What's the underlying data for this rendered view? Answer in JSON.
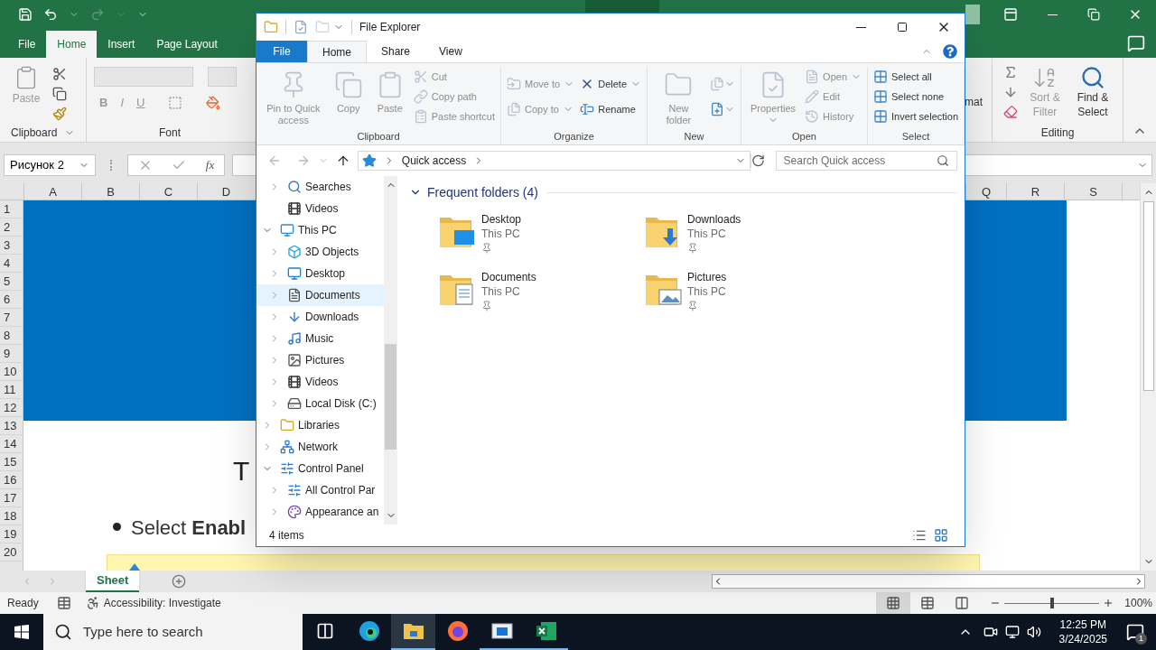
{
  "excel": {
    "tabs": [
      {
        "label": "File",
        "selected": false
      },
      {
        "label": "Home",
        "selected": true
      },
      {
        "label": "Insert",
        "selected": false
      },
      {
        "label": "Page Layout",
        "selected": false
      }
    ],
    "ribbon": {
      "clipboard": {
        "label": "Clipboard",
        "paste": {
          "label": "Paste",
          "disabled": true
        }
      },
      "font": {
        "label": "Font",
        "styles": [
          "B",
          "I",
          "U"
        ]
      },
      "format_fragment": "mat",
      "editing": {
        "label": "Editing",
        "sort_filter": {
          "label": "Sort & Filter",
          "disabled": true
        },
        "find_select": {
          "label": "Find & Select",
          "disabled": false
        }
      }
    },
    "name_box": "Рисунок 2",
    "formula_label": "fx",
    "columns_left": [
      "A",
      "B",
      "C",
      "D"
    ],
    "columns_right": [
      "Q",
      "R",
      "S"
    ],
    "rows": [
      "1",
      "2",
      "3",
      "4",
      "5",
      "6",
      "7",
      "8",
      "9",
      "10",
      "11",
      "12",
      "13",
      "14",
      "15",
      "16",
      "17",
      "18",
      "19",
      "20"
    ],
    "sheet_text": {
      "heading_fragment": "T",
      "bullet": "Select **Enabl**"
    },
    "sheet_tabs": [
      {
        "label": "Sheet",
        "selected": true
      }
    ],
    "status": {
      "mode": "Ready",
      "accessibility": "Accessibility: Investigate",
      "zoom": "100%",
      "zoom_slider": {
        "level": 0.5
      },
      "views": [
        {
          "selected": true
        },
        {
          "selected": false
        },
        {
          "selected": false
        }
      ]
    }
  },
  "explorer": {
    "title": "File Explorer",
    "tabs": [
      {
        "label": "File",
        "kind": "file",
        "selected": false
      },
      {
        "label": "Home",
        "kind": "tab",
        "selected": true
      },
      {
        "label": "Share",
        "kind": "tab",
        "selected": false
      },
      {
        "label": "View",
        "kind": "tab",
        "selected": false
      }
    ],
    "ribbon": [
      {
        "label": "Clipboard",
        "columns": [
          [
            {
              "label": "Pin to Quick access",
              "kind": "large",
              "disabled": true,
              "dropdown": false
            }
          ],
          [
            {
              "label": "Copy",
              "kind": "large",
              "disabled": true,
              "dropdown": false
            }
          ],
          [
            {
              "label": "Paste",
              "kind": "large",
              "disabled": true,
              "dropdown": false
            }
          ],
          [
            {
              "label": "Cut",
              "kind": "small",
              "disabled": true,
              "dropdown": false
            },
            {
              "label": "Copy path",
              "kind": "small",
              "disabled": true,
              "dropdown": false
            },
            {
              "label": "Paste shortcut",
              "kind": "small",
              "disabled": true,
              "dropdown": false
            }
          ]
        ]
      },
      {
        "label": "Organize",
        "columns": [
          [
            {
              "label": "Move to",
              "kind": "small",
              "disabled": true,
              "dropdown": true
            },
            {
              "label": "Copy to",
              "kind": "small",
              "disabled": true,
              "dropdown": true
            }
          ],
          [
            {
              "label": "Delete",
              "kind": "small",
              "disabled": false,
              "dropdown": true
            },
            {
              "label": "Rename",
              "kind": "small",
              "disabled": false,
              "dropdown": false
            }
          ]
        ]
      },
      {
        "label": "New",
        "columns": [
          [
            {
              "label": "New folder",
              "kind": "large",
              "disabled": true,
              "dropdown": false
            }
          ],
          [
            {
              "kind": "icon",
              "disabled": true,
              "dropdown": true
            },
            {
              "kind": "icon",
              "disabled": false,
              "dropdown": true
            }
          ]
        ]
      },
      {
        "label": "Open",
        "columns": [
          [
            {
              "label": "Properties",
              "kind": "large",
              "disabled": true,
              "dropdown": true
            }
          ],
          [
            {
              "label": "Open",
              "kind": "small",
              "disabled": true,
              "dropdown": true
            },
            {
              "label": "Edit",
              "kind": "small",
              "disabled": true,
              "dropdown": false
            },
            {
              "label": "History",
              "kind": "small",
              "disabled": true,
              "dropdown": false
            }
          ]
        ]
      },
      {
        "label": "Select",
        "columns": [
          [
            {
              "label": "Select all",
              "kind": "small",
              "disabled": false,
              "dropdown": false
            },
            {
              "label": "Select none",
              "kind": "small",
              "disabled": false,
              "dropdown": false
            },
            {
              "label": "Invert selection",
              "kind": "small",
              "disabled": false,
              "dropdown": false
            }
          ]
        ]
      }
    ],
    "address": "Quick access",
    "search": {
      "placeholder": "Search Quick access"
    },
    "nav": [
      {
        "children": [
          {
            "label": "Searches",
            "kind": "node",
            "expanded": false,
            "selected": false
          },
          {
            "label": "Videos",
            "kind": "leaf",
            "selected": false
          }
        ]
      },
      {
        "label": "This PC",
        "kind": "node",
        "expanded": true,
        "selected": false,
        "children": [
          {
            "label": "3D Objects",
            "kind": "node",
            "expanded": false,
            "selected": false
          },
          {
            "label": "Desktop",
            "kind": "node",
            "expanded": false,
            "selected": false
          },
          {
            "label": "Documents",
            "kind": "node",
            "expanded": false,
            "selected": true
          },
          {
            "label": "Downloads",
            "kind": "node",
            "expanded": false,
            "selected": false
          },
          {
            "label": "Music",
            "kind": "node",
            "expanded": false,
            "selected": false
          },
          {
            "label": "Pictures",
            "kind": "node",
            "expanded": false,
            "selected": false
          },
          {
            "label": "Videos",
            "kind": "node",
            "expanded": false,
            "selected": false
          },
          {
            "label": "Local Disk (C:)",
            "kind": "node",
            "expanded": false,
            "selected": false
          }
        ]
      },
      {
        "label": "Libraries",
        "kind": "node",
        "expanded": false,
        "selected": false
      },
      {
        "label": "Network",
        "kind": "node",
        "expanded": false,
        "selected": false
      },
      {
        "label": "Control Panel",
        "kind": "node",
        "expanded": true,
        "selected": false,
        "children": [
          {
            "label": "All Control Par",
            "kind": "node",
            "expanded": false,
            "selected": false
          },
          {
            "label": "Appearance an",
            "kind": "node",
            "expanded": false,
            "selected": false
          }
        ]
      }
    ],
    "section": {
      "title": "Frequent folders (4)",
      "expanded": true
    },
    "folders": [
      {
        "name": "Desktop",
        "location": "This PC",
        "pinned": true
      },
      {
        "name": "Downloads",
        "location": "This PC",
        "pinned": true
      },
      {
        "name": "Documents",
        "location": "This PC",
        "pinned": true
      },
      {
        "name": "Pictures",
        "location": "This PC",
        "pinned": true
      }
    ],
    "status": "4 items"
  },
  "taskbar": {
    "search_placeholder": "Type here to search",
    "apps": [
      {
        "selected": false,
        "running": false
      },
      {
        "selected": false,
        "running": false
      },
      {
        "selected": true,
        "running": true
      },
      {
        "selected": false,
        "running": false
      },
      {
        "selected": false,
        "running": true
      },
      {
        "selected": false,
        "running": true
      }
    ],
    "time": "12:25 PM",
    "date": "3/24/2025",
    "notifications": "1"
  }
}
